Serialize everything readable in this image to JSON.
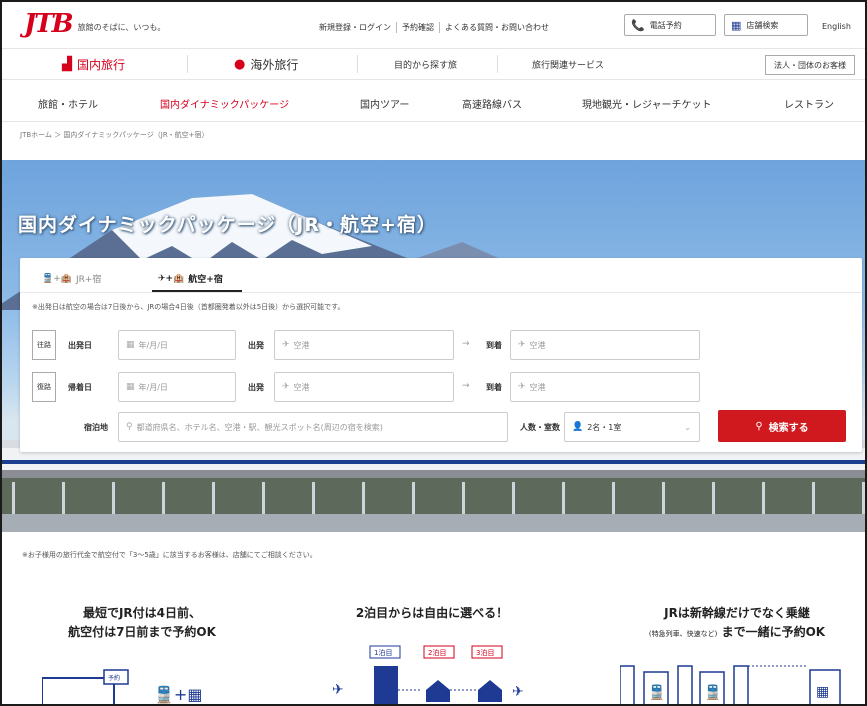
{
  "header": {
    "logo": "JTB",
    "tagline": "旅館のそばに、いつも。",
    "links": [
      "新規登録・ログイン",
      "予約確認",
      "よくある質問・お問い合わせ"
    ],
    "phone_button": "電話予約",
    "store_button": "店舗検索",
    "english": "English"
  },
  "main_nav": {
    "domestic": "国内旅行",
    "overseas": "海外旅行",
    "by_purpose": "目的から探す旅",
    "services": "旅行関連サービス",
    "corporate": "法人・団体のお客様"
  },
  "sub_nav": [
    "旅館・ホテル",
    "国内ダイナミックパッケージ",
    "国内ツアー",
    "高速路線バス",
    "現地観光・レジャーチケット",
    "レストラン"
  ],
  "breadcrumb": "JTBホーム ＞ 国内ダイナミックパッケージ（JR・航空+宿）",
  "hero": {
    "title": "国内ダイナミックパッケージ（JR・航空+宿）"
  },
  "search": {
    "tab_jr": "JR+宿",
    "tab_air": "航空+宿",
    "note": "※出発日は航空の場合は7日後から、JRの場合4日後（首都圏発着以外は5日後）から選択可能です。",
    "outbound": {
      "badge": "往路",
      "date_label": "出発日",
      "date_placeholder": "年/月/日",
      "from_label": "出発",
      "from_placeholder": "空港",
      "to_label": "到着",
      "to_placeholder": "空港"
    },
    "return": {
      "badge": "復路",
      "date_label": "帰着日",
      "date_placeholder": "年/月/日",
      "from_label": "出発",
      "from_placeholder": "空港",
      "to_label": "到着",
      "to_placeholder": "空港"
    },
    "dest_label": "宿泊地",
    "dest_placeholder": "都道府県名、ホテル名、空港・駅、観光スポット名(周辺の宿を検索)",
    "guests_label": "人数・室数",
    "guests_value": "2名・1室",
    "search_button": "検索する"
  },
  "footnote": "※お子様用の旅行代金で航空付で「3〜5歳」に該当するお客様は、店舗にてご相談ください。",
  "features": [
    {
      "line1": "最短でJR付は4日前、",
      "line2": "航空付は7日前まで予約OK"
    },
    {
      "line1": "2泊目からは自由に選べる！",
      "line2": ""
    },
    {
      "line1": "JRは新幹線だけでなく乗継",
      "line2_small": "(特急列車、快速など)",
      "line2": "まで一緒に予約OK"
    }
  ],
  "illus": {
    "day1": "1泊目",
    "day2": "2泊目",
    "day3": "3泊目",
    "reserve": "予約"
  },
  "colors": {
    "brand_red": "#d6001c",
    "button_red": "#d0191e",
    "navy": "#1f3a93"
  }
}
